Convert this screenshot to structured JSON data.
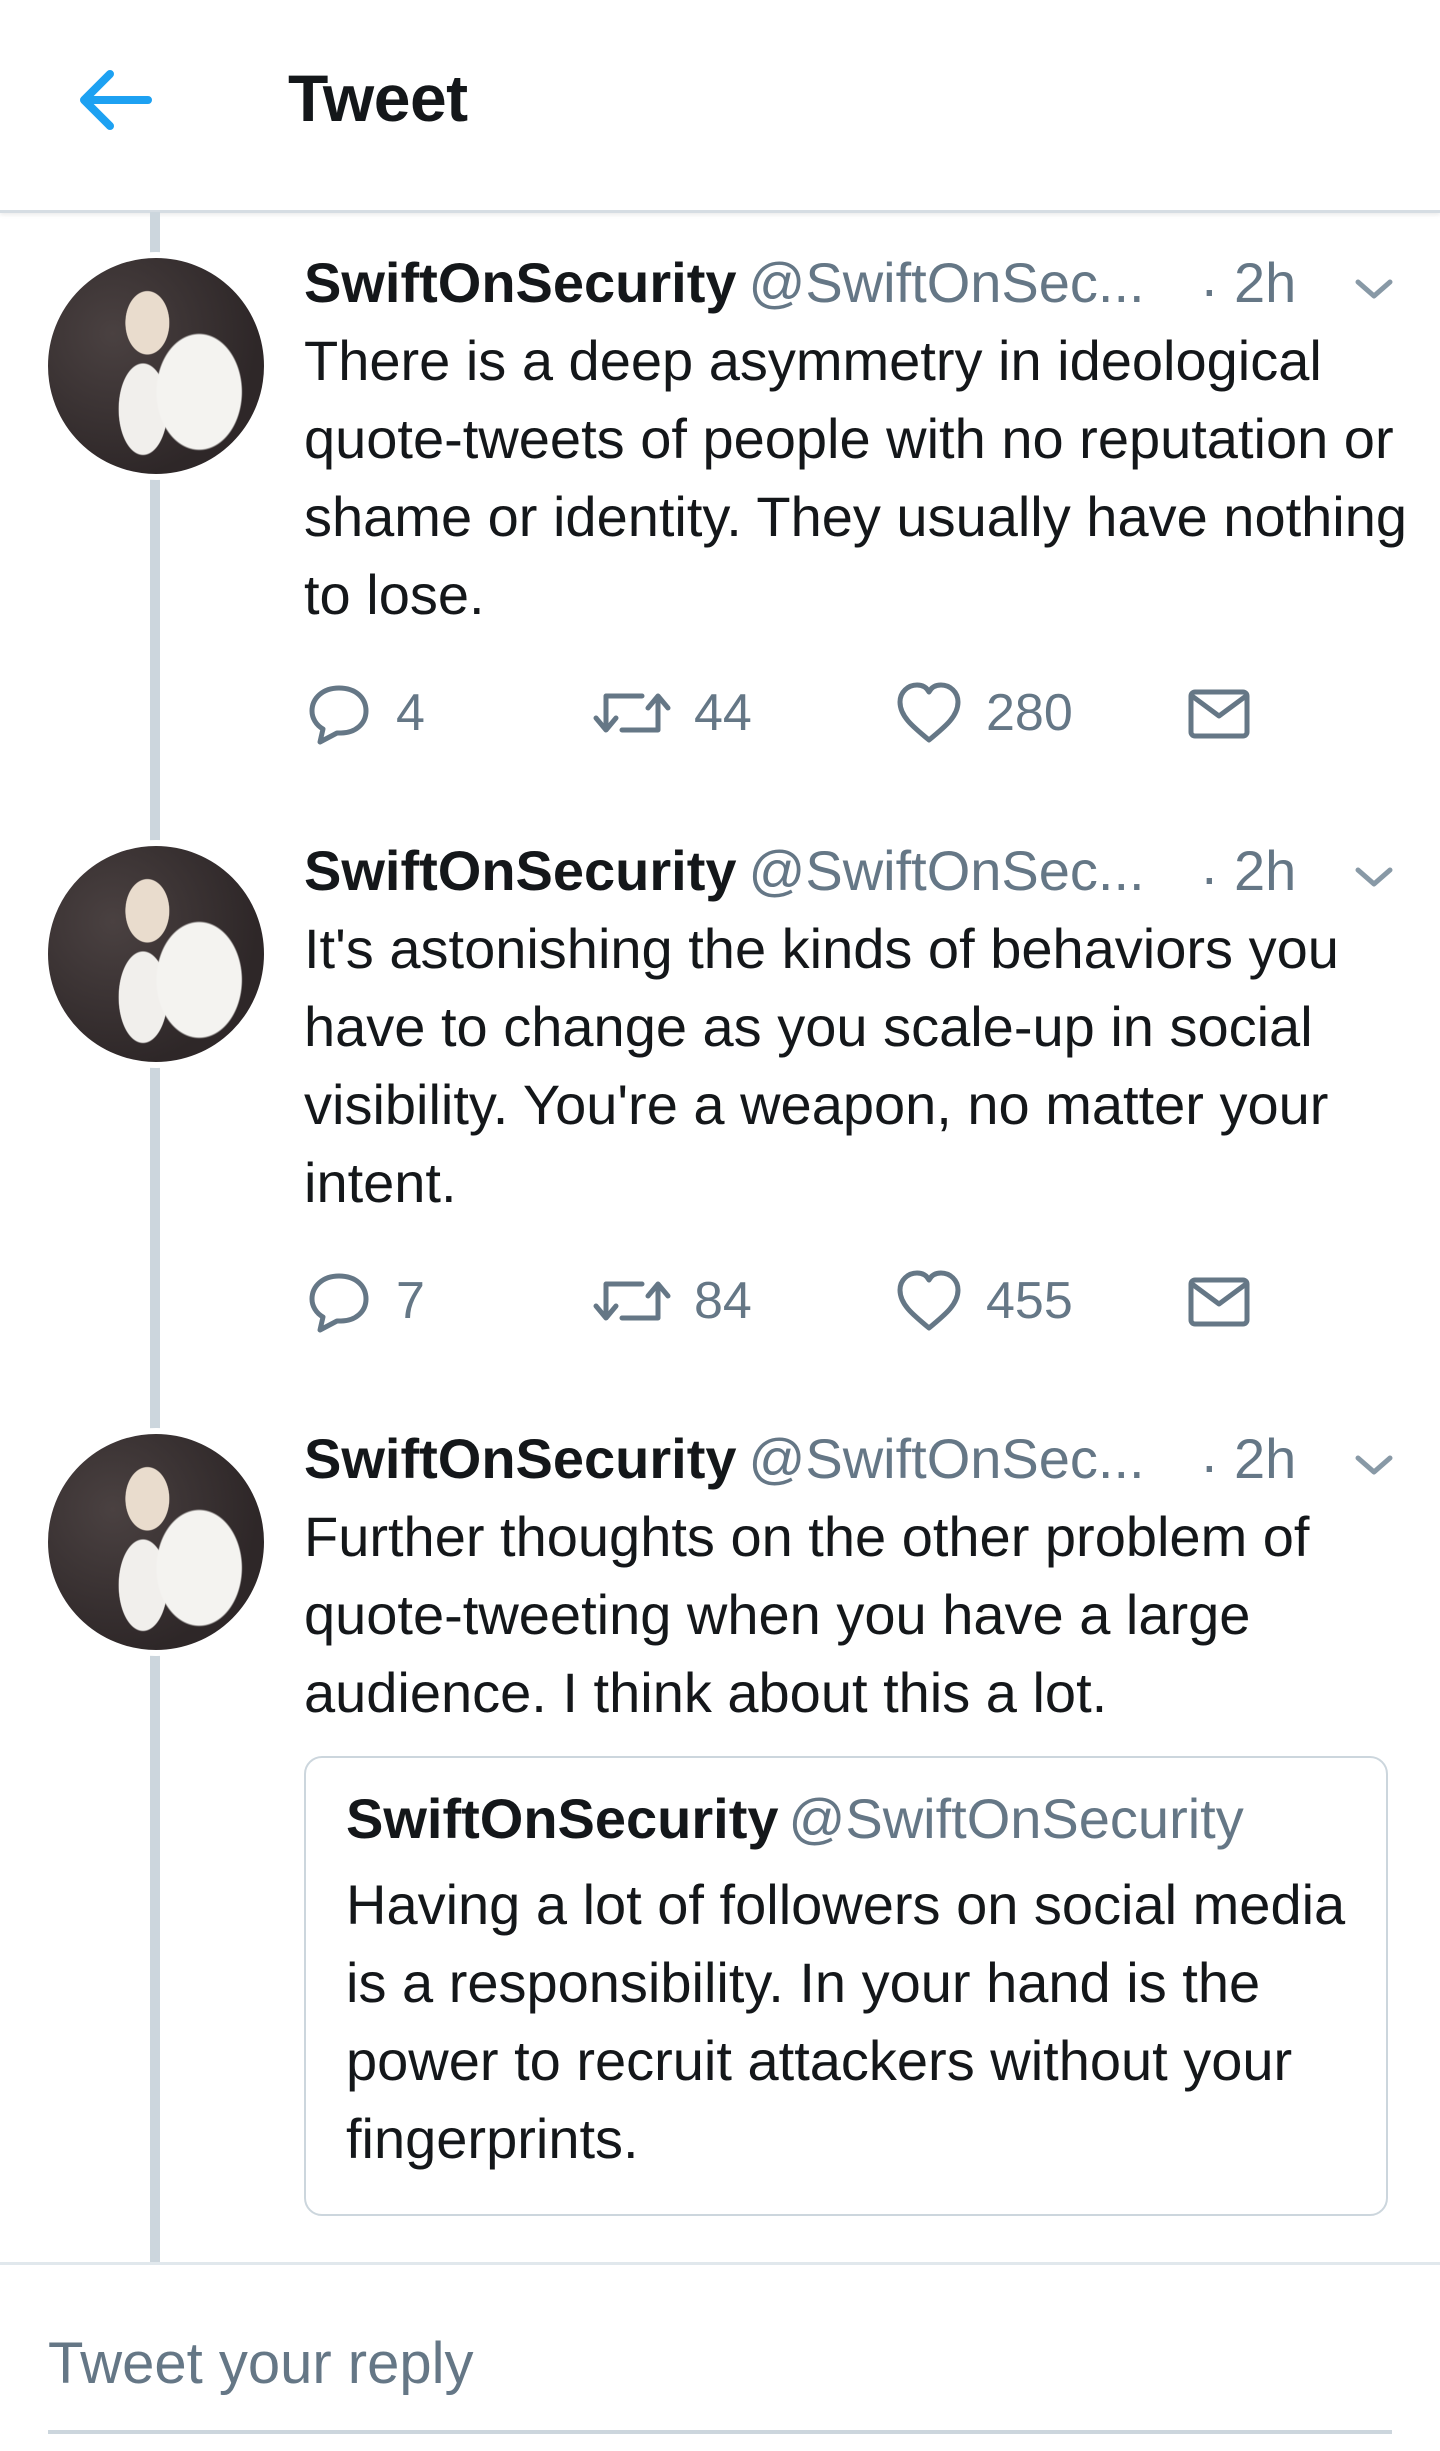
{
  "topbar": {
    "title": "Tweet",
    "back_icon": "arrow-left-icon",
    "accent": "#1da1f2"
  },
  "tweets": [
    {
      "name": "SwiftOnSecurity",
      "handle": "@SwiftOnSec...",
      "dot": "·",
      "time": "2h",
      "text": "There is a deep asymmetry in ideological quote-tweets of people with no reputation or shame or identity. They usually have nothing to lose.",
      "replies": "4",
      "retweets": "44",
      "likes": "280"
    },
    {
      "name": "SwiftOnSecurity",
      "handle": "@SwiftOnSec...",
      "dot": "·",
      "time": "2h",
      "text": "It's astonishing the kinds of behaviors you have to change as you scale-up in social visibility. You're a weapon, no matter your intent.",
      "replies": "7",
      "retweets": "84",
      "likes": "455"
    },
    {
      "name": "SwiftOnSecurity",
      "handle": "@SwiftOnSec...",
      "dot": "·",
      "time": "2h",
      "text": "Further thoughts on the other problem of quote-tweeting when you have a large audience. I think about this a lot.",
      "quoted": {
        "name": "SwiftOnSecurity",
        "handle": "@SwiftOnSecurity",
        "text": "Having a lot of followers on social media is a responsibility. In your hand is the power to recruit attackers without your fingerprints."
      }
    }
  ],
  "reply": {
    "placeholder": "Tweet your reply"
  },
  "colors": {
    "secondary_text": "#657786",
    "thread_line": "#ccd6dd",
    "icon": "#657786"
  }
}
